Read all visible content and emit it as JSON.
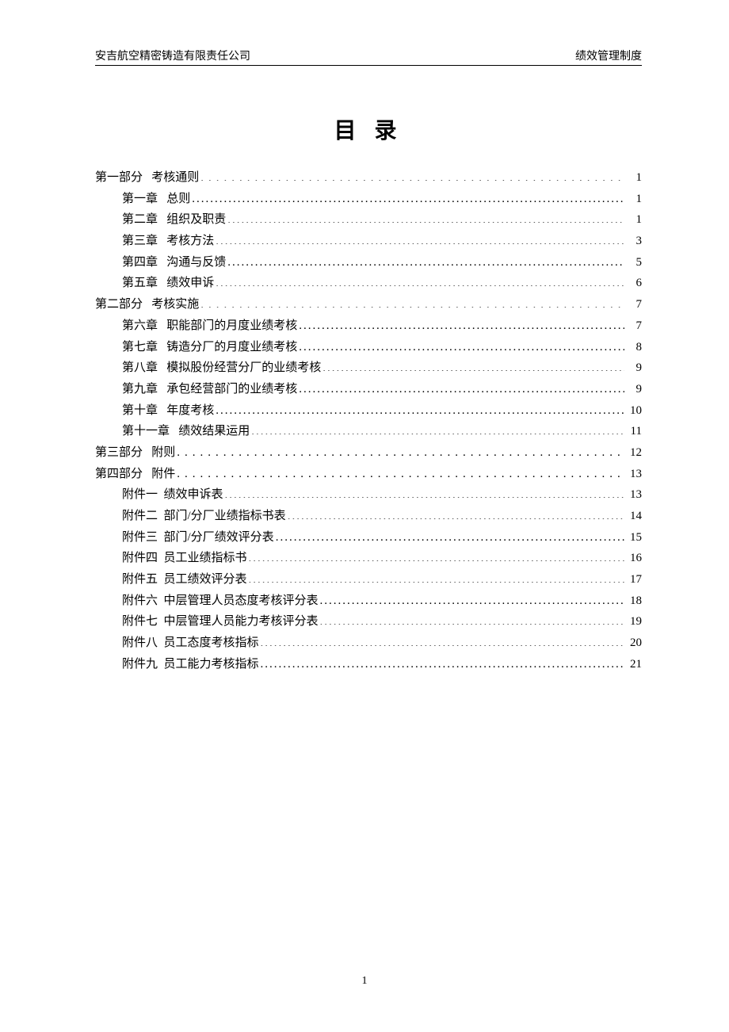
{
  "header": {
    "left": "安吉航空精密铸造有限责任公司",
    "right": "绩效管理制度"
  },
  "title": "目  录",
  "toc": [
    {
      "level": 0,
      "num": "第一部分",
      "gap": "   ",
      "text": "考核通则",
      "page": "1",
      "bigDots": true
    },
    {
      "level": 1,
      "num": "第一章",
      "gap": "   ",
      "text": "总则",
      "page": "1"
    },
    {
      "level": 1,
      "num": "第二章",
      "gap": "   ",
      "text": "组织及职责",
      "page": "1"
    },
    {
      "level": 1,
      "num": "第三章",
      "gap": "   ",
      "text": "考核方法",
      "page": "3"
    },
    {
      "level": 1,
      "num": "第四章",
      "gap": "   ",
      "text": "沟通与反馈",
      "page": "5"
    },
    {
      "level": 1,
      "num": "第五章",
      "gap": "   ",
      "text": "绩效申诉",
      "page": "6"
    },
    {
      "level": 0,
      "num": "第二部分",
      "gap": "   ",
      "text": "考核实施",
      "page": "7",
      "bigDots": true
    },
    {
      "level": 1,
      "num": "第六章",
      "gap": "   ",
      "text": "职能部门的月度业绩考核",
      "page": "7"
    },
    {
      "level": 1,
      "num": "第七章",
      "gap": "   ",
      "text": "铸造分厂的月度业绩考核",
      "page": "8"
    },
    {
      "level": 1,
      "num": "第八章",
      "gap": "   ",
      "text": "模拟股份经营分厂的业绩考核",
      "page": "9"
    },
    {
      "level": 1,
      "num": "第九章",
      "gap": "   ",
      "text": "承包经营部门的业绩考核",
      "page": "9"
    },
    {
      "level": 1,
      "num": "第十章",
      "gap": "   ",
      "text": "年度考核",
      "page": "10"
    },
    {
      "level": 1,
      "num": "第十一章",
      "gap": "   ",
      "text": "绩效结果运用",
      "page": "11"
    },
    {
      "level": 0,
      "num": "第三部分",
      "gap": "   ",
      "text": "附则",
      "page": "12",
      "bigDots": true
    },
    {
      "level": 0,
      "num": "第四部分",
      "gap": "   ",
      "text": "附件",
      "page": "13",
      "bigDots": true
    },
    {
      "level": 1,
      "num": "附件一",
      "gap": "  ",
      "text": "绩效申诉表",
      "page": "13"
    },
    {
      "level": 1,
      "num": "附件二",
      "gap": "  ",
      "text": "部门/分厂业绩指标书表",
      "page": "14"
    },
    {
      "level": 1,
      "num": "附件三",
      "gap": "  ",
      "text": "部门/分厂绩效评分表",
      "page": "15"
    },
    {
      "level": 1,
      "num": "附件四",
      "gap": "  ",
      "text": "员工业绩指标书",
      "page": "16"
    },
    {
      "level": 1,
      "num": "附件五",
      "gap": "  ",
      "text": "员工绩效评分表",
      "page": "17"
    },
    {
      "level": 1,
      "num": "附件六",
      "gap": "  ",
      "text": "中层管理人员态度考核评分表",
      "page": "18"
    },
    {
      "level": 1,
      "num": "附件七",
      "gap": "  ",
      "text": "中层管理人员能力考核评分表",
      "page": "19"
    },
    {
      "level": 1,
      "num": "附件八",
      "gap": "  ",
      "text": "员工态度考核指标",
      "page": "20"
    },
    {
      "level": 1,
      "num": "附件九",
      "gap": "  ",
      "text": "员工能力考核指标",
      "page": "21"
    }
  ],
  "footer": {
    "pageNumber": "1"
  }
}
